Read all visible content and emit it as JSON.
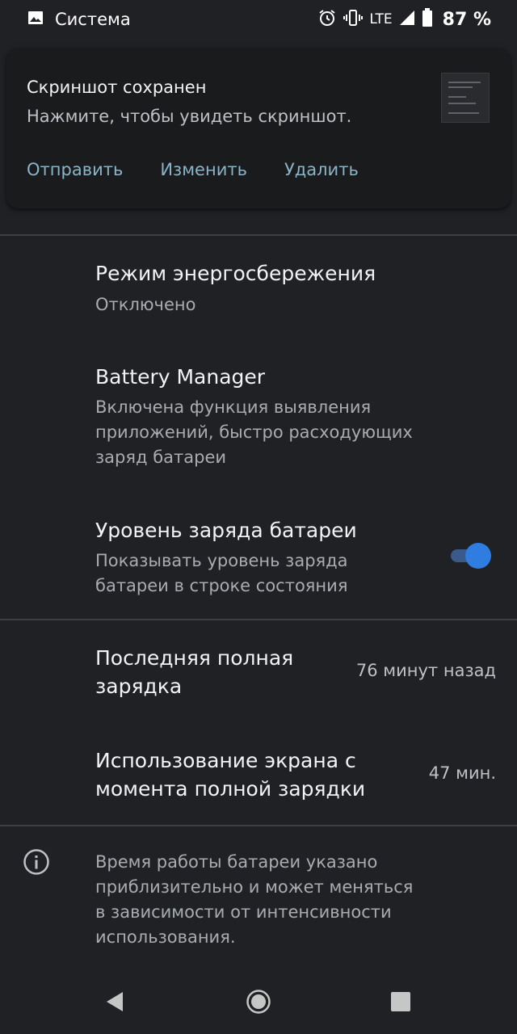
{
  "status_bar": {
    "app_name": "Система",
    "network": "LTE",
    "battery_percent": "87 %"
  },
  "notification": {
    "title": "Скриншот сохранен",
    "text": "Нажмите, чтобы увидеть скриншот.",
    "actions": [
      "Отправить",
      "Изменить",
      "Удалить"
    ]
  },
  "settings": {
    "power_saving": {
      "title": "Режим энергосбережения",
      "subtitle": "Отключено"
    },
    "battery_manager": {
      "title": "Battery Manager",
      "subtitle_lines": [
        "Включена функция выявления",
        "приложений, быстро расходующих",
        "заряд батареи"
      ]
    },
    "battery_level": {
      "title": "Уровень заряда батареи",
      "subtitle_lines": [
        "Показывать уровень заряда",
        "батареи в строке состояния"
      ],
      "enabled": true
    },
    "last_full_charge": {
      "title_lines": [
        "Последняя полная",
        "зарядка"
      ],
      "value": "76 минут назад"
    },
    "screen_usage": {
      "title_lines": [
        "Использование экрана с",
        "момента полной зарядки"
      ],
      "value": "47 мин."
    }
  },
  "info": {
    "text_lines": [
      "Время работы батареи указано",
      "приблизительно и может меняться",
      "в зависимости от интенсивности",
      "использования."
    ]
  },
  "colors": {
    "background": "#202124",
    "accent": "#2f7de1",
    "action_text": "#8ab4c8"
  },
  "icons": {
    "status_left": "image-icon",
    "status_right": [
      "alarm-icon",
      "vibrate-icon",
      "signal-icon",
      "battery-icon"
    ],
    "info": "info-icon",
    "nav": [
      "back-icon",
      "home-icon",
      "recents-icon"
    ]
  }
}
